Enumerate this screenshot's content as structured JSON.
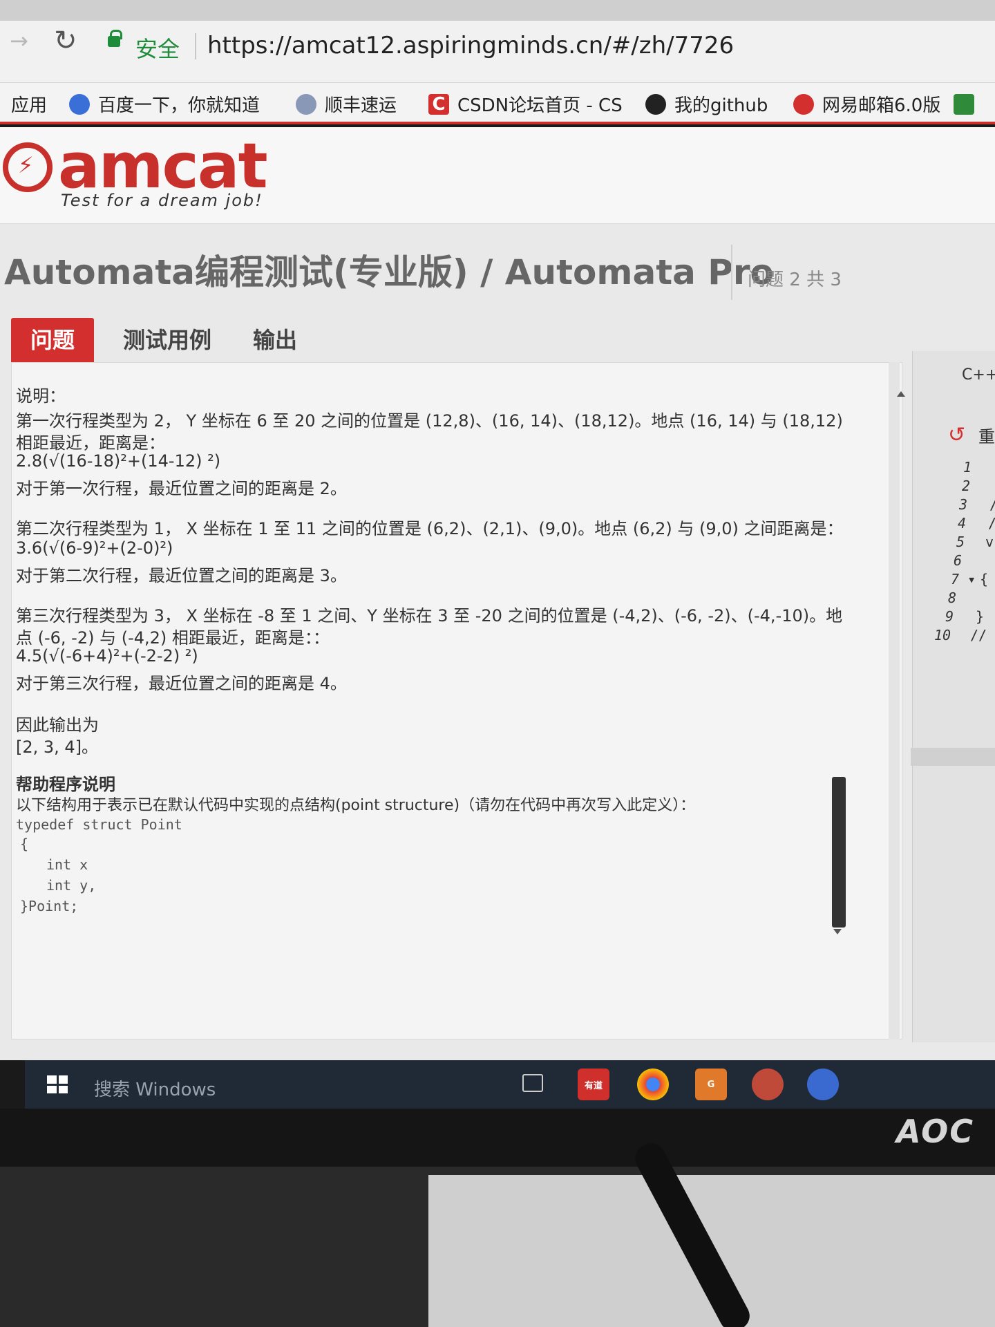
{
  "browser": {
    "secure_label": "安全",
    "url": "https://amcat12.aspiringminds.cn/#/zh/7726"
  },
  "bookmarks": [
    {
      "label": "应用",
      "icon": "apps-icon"
    },
    {
      "label": "百度一下，你就知道",
      "icon": "baidu-icon"
    },
    {
      "label": "顺丰速运",
      "icon": "sf-express-icon"
    },
    {
      "label": "CSDN论坛首页 - CS",
      "icon": "csdn-icon"
    },
    {
      "label": "我的github",
      "icon": "github-icon"
    },
    {
      "label": "网易邮箱6.0版",
      "icon": "netease-mail-icon"
    }
  ],
  "header": {
    "logo_text": "amcat",
    "tagline": "Test for a dream job!"
  },
  "page": {
    "title": "Automata编程测试(专业版) / Automata Pro",
    "question_counter": "问题 2 共 3"
  },
  "tabs": [
    {
      "label": "问题",
      "active": true
    },
    {
      "label": "测试用例",
      "active": false
    },
    {
      "label": "输出",
      "active": false
    }
  ],
  "question": {
    "explain_label": "说明：",
    "p1": [
      "第一次行程类型为 2， Y 坐标在 6 至 20 之间的位置是 (12,8)、(16, 14)、(18,12)。地点 (16, 14) 与 (18,12)",
      "相距最近，距离是：",
      "2.8(√(16-18)²+(14-12) ²)",
      "对于第一次行程，最近位置之间的距离是 2。"
    ],
    "p2": [
      "第二次行程类型为 1， X 坐标在 1 至 11 之间的位置是 (6,2)、(2,1)、(9,0)。地点 (6,2) 与 (9,0) 之间距离是：",
      "3.6(√(6-9)²+(2-0)²)",
      "对于第二次行程，最近位置之间的距离是 3。"
    ],
    "p3": [
      "第三次行程类型为 3， X 坐标在 -8 至 1 之间、Y 坐标在 3 至 -20 之间的位置是 (-4,2)、(-6, -2)、(-4,-10)。地",
      "点 (-6, -2) 与 (-4,2) 相距最近，距离是：：",
      "4.5(√(-6+4)²+(-2-2) ²)",
      "对于第三次行程，最近位置之间的距离是 4。"
    ],
    "output_label": "因此输出为",
    "output_value": "[2, 3, 4]。",
    "help_title": "帮助程序说明",
    "help_desc": "以下结构用于表示已在默认代码中实现的点结构(point structure)（请勿在代码中再次写入此定义）：",
    "code": [
      "typedef struct Point",
      "{",
      "int x",
      "int y,",
      "}Point;"
    ]
  },
  "editor": {
    "language": "C++",
    "reset_label": "重",
    "gutter": [
      {
        "n": "1",
        "c": ""
      },
      {
        "n": "2",
        "c": ""
      },
      {
        "n": "3",
        "c": "/"
      },
      {
        "n": "4",
        "c": "/"
      },
      {
        "n": "5",
        "c": "v"
      },
      {
        "n": "6",
        "c": ""
      },
      {
        "n": "7 ▾",
        "c": "{"
      },
      {
        "n": "8",
        "c": ""
      },
      {
        "n": "9",
        "c": "}"
      },
      {
        "n": "10",
        "c": "//"
      }
    ]
  },
  "taskbar": {
    "search_placeholder": "搜索 Windows",
    "apps": [
      {
        "label": "有道",
        "icon": "youdao-icon",
        "color": "#d0302c"
      },
      {
        "label": "",
        "icon": "chrome-icon",
        "color": "#e8e8e8"
      },
      {
        "label": "G",
        "icon": "app-orange-icon",
        "color": "#e07a2a"
      },
      {
        "label": "",
        "icon": "app-red-icon",
        "color": "#c04a3a"
      },
      {
        "label": "",
        "icon": "app-blue-icon",
        "color": "#3a6ad0"
      }
    ]
  },
  "monitor": {
    "brand": "AOC"
  }
}
